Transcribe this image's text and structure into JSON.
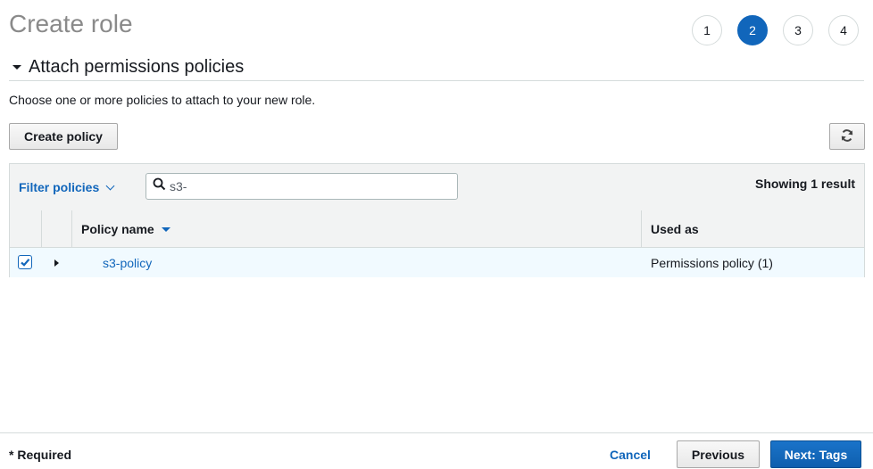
{
  "page": {
    "title": "Create role",
    "steps": [
      {
        "label": "1",
        "active": false
      },
      {
        "label": "2",
        "active": true
      },
      {
        "label": "3",
        "active": false
      },
      {
        "label": "4",
        "active": false
      }
    ]
  },
  "section": {
    "title": "Attach permissions policies",
    "description": "Choose one or more policies to attach to your new role."
  },
  "actions": {
    "create_policy_label": "Create policy",
    "refresh_icon": "refresh-icon"
  },
  "table": {
    "filter_label": "Filter policies",
    "search_value": "s3-",
    "search_placeholder": "",
    "result_count": "Showing 1 result",
    "columns": {
      "name": "Policy name",
      "used_as": "Used as"
    },
    "rows": [
      {
        "selected": true,
        "name": "s3-policy",
        "used_as": "Permissions policy (1)"
      }
    ]
  },
  "footer": {
    "required_label": "* Required",
    "cancel_label": "Cancel",
    "previous_label": "Previous",
    "next_label": "Next: Tags"
  },
  "colors": {
    "accent": "#1166bb",
    "header_bg": "#f2f3f3",
    "selected_row_bg": "#f1faff"
  }
}
